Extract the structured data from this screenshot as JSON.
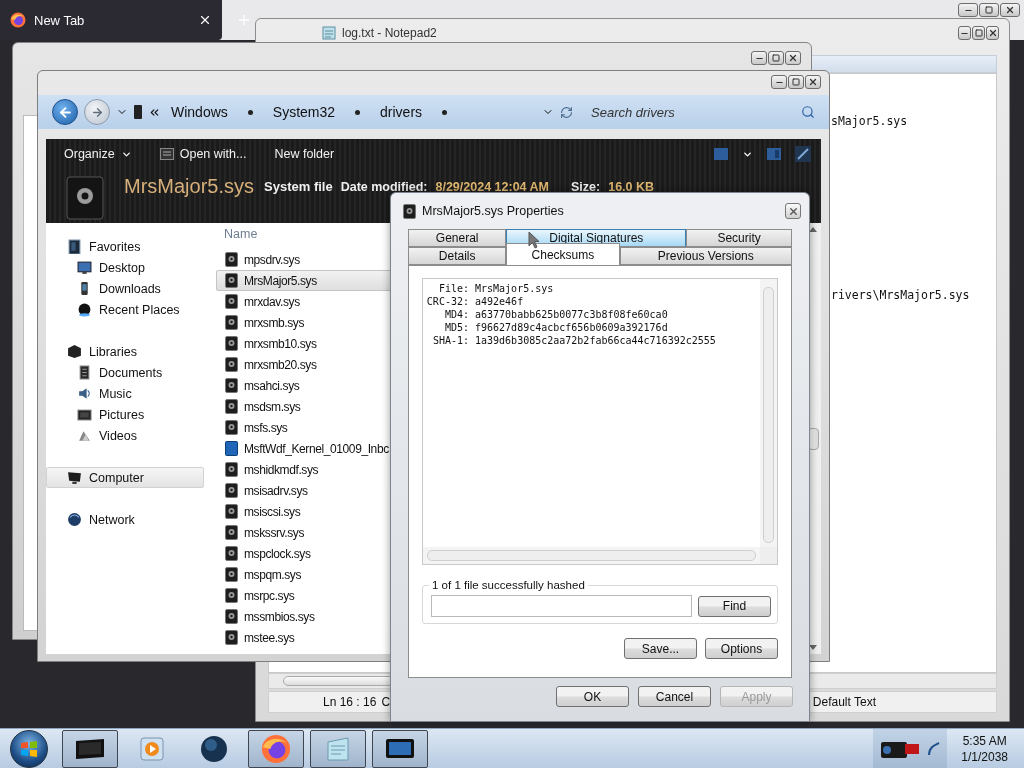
{
  "browser": {
    "tabs": [
      {
        "title": "New Tab",
        "selected": true
      }
    ]
  },
  "notepad": {
    "title": "log.txt - Notepad2",
    "lines": [
      "sMajor5.sys",
      "rivers\\MrsMajor5.sys"
    ],
    "status": {
      "position": "Ln 16 : 16",
      "column": "C",
      "scheme": "Default Text"
    }
  },
  "explorer": {
    "breadcrumbs": [
      "Windows",
      "System32",
      "drivers"
    ],
    "search": {
      "placeholder": "Search drivers"
    },
    "toolbar": [
      {
        "label": "Organize",
        "kind": "menu"
      },
      {
        "label": "Open with...",
        "kind": "open"
      },
      {
        "label": "New folder",
        "kind": "plain"
      }
    ],
    "details": {
      "name": "MrsMajor5.sys",
      "type": "System file",
      "fields": [
        {
          "label": "Date modified:",
          "value": "8/29/2024 12:04 AM"
        },
        {
          "label": "Size:",
          "value": "16.0 KB"
        }
      ]
    },
    "nav": [
      {
        "label": "Favorites",
        "kind": "favorites",
        "selected": false,
        "children": [
          {
            "label": "Desktop",
            "kind": "desktop",
            "selected": false
          },
          {
            "label": "Downloads",
            "kind": "downloads",
            "selected": false
          },
          {
            "label": "Recent Places",
            "kind": "recent",
            "selected": false
          }
        ]
      },
      {
        "label": "Libraries",
        "kind": "libraries",
        "selected": false,
        "children": [
          {
            "label": "Documents",
            "kind": "documents",
            "selected": false
          },
          {
            "label": "Music",
            "kind": "music",
            "selected": false
          },
          {
            "label": "Pictures",
            "kind": "pictures",
            "selected": false
          },
          {
            "label": "Videos",
            "kind": "videos",
            "selected": false
          }
        ]
      },
      {
        "label": "Computer",
        "kind": "computer",
        "selected": true
      },
      {
        "label": "Network",
        "kind": "network",
        "selected": false
      }
    ],
    "column": "Name",
    "files": [
      {
        "name": "mpsdrv.sys",
        "kind": "sys",
        "selected": false
      },
      {
        "name": "MrsMajor5.sys",
        "kind": "sys",
        "selected": true
      },
      {
        "name": "mrxdav.sys",
        "kind": "sys",
        "selected": false
      },
      {
        "name": "mrxsmb.sys",
        "kind": "sys",
        "selected": false
      },
      {
        "name": "mrxsmb10.sys",
        "kind": "sys",
        "selected": false
      },
      {
        "name": "mrxsmb20.sys",
        "kind": "sys",
        "selected": false
      },
      {
        "name": "msahci.sys",
        "kind": "sys",
        "selected": false
      },
      {
        "name": "msdsm.sys",
        "kind": "sys",
        "selected": false
      },
      {
        "name": "msfs.sys",
        "kind": "sys",
        "selected": false
      },
      {
        "name": "MsftWdf_Kernel_01009_Inbc",
        "kind": "package",
        "selected": false
      },
      {
        "name": "mshidkmdf.sys",
        "kind": "sys",
        "selected": false
      },
      {
        "name": "msisadrv.sys",
        "kind": "sys",
        "selected": false
      },
      {
        "name": "msiscsi.sys",
        "kind": "sys",
        "selected": false
      },
      {
        "name": "mskssrv.sys",
        "kind": "sys",
        "selected": false
      },
      {
        "name": "mspclock.sys",
        "kind": "sys",
        "selected": false
      },
      {
        "name": "mspqm.sys",
        "kind": "sys",
        "selected": false
      },
      {
        "name": "msrpc.sys",
        "kind": "sys",
        "selected": false
      },
      {
        "name": "mssmbios.sys",
        "kind": "sys",
        "selected": false
      },
      {
        "name": "mstee.sys",
        "kind": "sys",
        "selected": false
      }
    ]
  },
  "dialog": {
    "title": "MrsMajor5.sys Properties",
    "tab_rows": [
      [
        {
          "label": "General",
          "selected": false,
          "hovered": false
        },
        {
          "label": "Digital Signatures",
          "selected": false,
          "hovered": true
        },
        {
          "label": "Security",
          "selected": false,
          "hovered": false
        }
      ],
      [
        {
          "label": "Details",
          "selected": false,
          "hovered": false
        },
        {
          "label": "Checksums",
          "selected": true,
          "hovered": false
        },
        {
          "label": "Previous Versions",
          "selected": false,
          "hovered": false
        }
      ]
    ],
    "hashes": [
      {
        "label": "File:",
        "value": "MrsMajor5.sys"
      },
      {
        "label": "CRC-32:",
        "value": "a492e46f"
      },
      {
        "label": "MD4:",
        "value": "a63770babb625b0077c3b8f08fe60ca0"
      },
      {
        "label": "MD5:",
        "value": "f96627d89c4acbcf656b0609a392176d"
      },
      {
        "label": "SHA-1:",
        "value": "1a39d6b3085c2aa72b2fab66ca44c716392c2555"
      }
    ],
    "group_label": "1 of 1 file successfully hashed",
    "find": "Find",
    "actions": [
      "Save...",
      "Options"
    ],
    "buttons": [
      {
        "label": "OK",
        "disabled": false
      },
      {
        "label": "Cancel",
        "disabled": false
      },
      {
        "label": "Apply",
        "disabled": true
      }
    ]
  },
  "taskbar": {
    "apps": [
      {
        "kind": "terminal",
        "open": true
      },
      {
        "kind": "media",
        "open": false
      },
      {
        "kind": "globe",
        "open": false
      },
      {
        "kind": "firefox",
        "open": true
      },
      {
        "kind": "notepad",
        "open": true
      },
      {
        "kind": "monitor",
        "open": true
      }
    ],
    "time": "5:35 AM",
    "date": "1/1/2038"
  }
}
